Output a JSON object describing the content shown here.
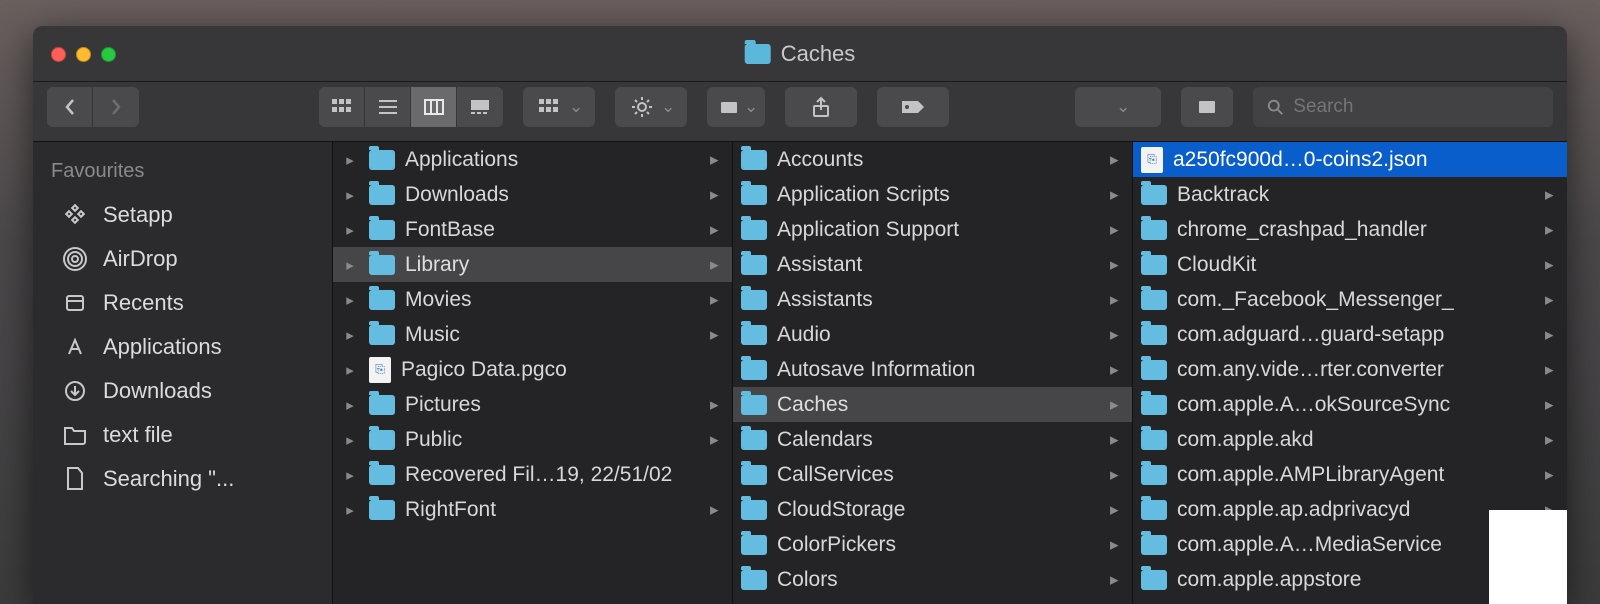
{
  "window": {
    "title": "Caches"
  },
  "search": {
    "placeholder": "Search"
  },
  "sidebar": {
    "heading": "Favourites",
    "items": [
      {
        "label": "Setapp"
      },
      {
        "label": "AirDrop"
      },
      {
        "label": "Recents"
      },
      {
        "label": "Applications"
      },
      {
        "label": "Downloads"
      },
      {
        "label": "text file"
      },
      {
        "label": "Searching \"..."
      }
    ]
  },
  "columns": [
    {
      "selected": 3,
      "items": [
        {
          "label": "Applications",
          "type": "folder",
          "arrow": true
        },
        {
          "label": "Downloads",
          "type": "folder",
          "arrow": true
        },
        {
          "label": "FontBase",
          "type": "folder",
          "arrow": true
        },
        {
          "label": "Library",
          "type": "folder",
          "arrow": true
        },
        {
          "label": "Movies",
          "type": "folder",
          "arrow": true
        },
        {
          "label": "Music",
          "type": "folder",
          "arrow": true
        },
        {
          "label": "Pagico Data.pgco",
          "type": "file",
          "arrow": false
        },
        {
          "label": "Pictures",
          "type": "folder",
          "arrow": true
        },
        {
          "label": "Public",
          "type": "folder",
          "arrow": true
        },
        {
          "label": "Recovered Fil…19, 22/51/02",
          "type": "folder",
          "arrow": false
        },
        {
          "label": "RightFont",
          "type": "folder",
          "arrow": true
        }
      ]
    },
    {
      "selected": 7,
      "items": [
        {
          "label": "Accounts",
          "type": "folder",
          "arrow": true
        },
        {
          "label": "Application Scripts",
          "type": "folder",
          "arrow": true
        },
        {
          "label": "Application Support",
          "type": "folder",
          "arrow": true
        },
        {
          "label": "Assistant",
          "type": "folder",
          "arrow": true
        },
        {
          "label": "Assistants",
          "type": "folder",
          "arrow": true
        },
        {
          "label": "Audio",
          "type": "folder",
          "arrow": true
        },
        {
          "label": "Autosave Information",
          "type": "folder",
          "arrow": true
        },
        {
          "label": "Caches",
          "type": "folder",
          "arrow": true
        },
        {
          "label": "Calendars",
          "type": "folder",
          "arrow": true
        },
        {
          "label": "CallServices",
          "type": "folder",
          "arrow": true
        },
        {
          "label": "CloudStorage",
          "type": "folder",
          "arrow": true
        },
        {
          "label": "ColorPickers",
          "type": "folder",
          "arrow": true
        },
        {
          "label": "Colors",
          "type": "folder",
          "arrow": true
        }
      ]
    },
    {
      "selected": 0,
      "active": true,
      "items": [
        {
          "label": "a250fc900d…0-coins2.json",
          "type": "file",
          "arrow": false
        },
        {
          "label": "Backtrack",
          "type": "folder",
          "arrow": true
        },
        {
          "label": "chrome_crashpad_handler",
          "type": "folder",
          "arrow": true
        },
        {
          "label": "CloudKit",
          "type": "folder",
          "arrow": true
        },
        {
          "label": "com._Facebook_Messenger_",
          "type": "folder",
          "arrow": true
        },
        {
          "label": "com.adguard…guard-setapp",
          "type": "folder",
          "arrow": true
        },
        {
          "label": "com.any.vide…rter.converter",
          "type": "folder",
          "arrow": true
        },
        {
          "label": "com.apple.A…okSourceSync",
          "type": "folder",
          "arrow": true
        },
        {
          "label": "com.apple.akd",
          "type": "folder",
          "arrow": true
        },
        {
          "label": "com.apple.AMPLibraryAgent",
          "type": "folder",
          "arrow": true
        },
        {
          "label": "com.apple.ap.adprivacyd",
          "type": "folder",
          "arrow": true
        },
        {
          "label": "com.apple.A…MediaService",
          "type": "folder",
          "arrow": true
        },
        {
          "label": "com.apple.appstore",
          "type": "folder",
          "arrow": true
        }
      ]
    }
  ]
}
